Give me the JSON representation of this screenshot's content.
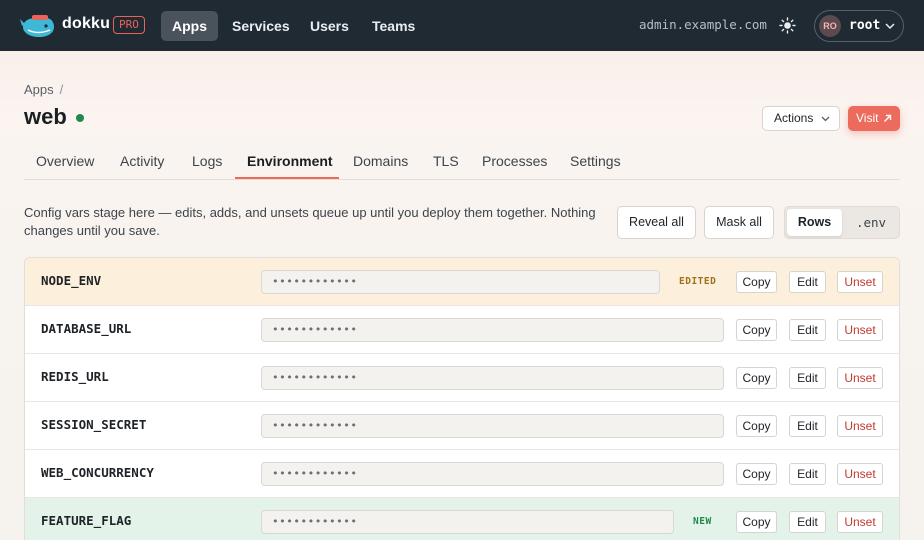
{
  "topbar": {
    "brand": "dokku",
    "pro_badge": "PRO",
    "nav": [
      {
        "label": "Apps",
        "active": true
      },
      {
        "label": "Services",
        "active": false
      },
      {
        "label": "Users",
        "active": false
      },
      {
        "label": "Teams",
        "active": false
      }
    ],
    "host": "admin.example.com",
    "theme_icon": "sun-icon",
    "user": {
      "initials": "RO",
      "name": "root"
    }
  },
  "breadcrumb": {
    "parent": "Apps",
    "separator": "/"
  },
  "app": {
    "name": "web",
    "status": "running",
    "status_color": "#1f8a4c"
  },
  "header_actions": {
    "actions_label": "Actions",
    "visit_label": "Visit"
  },
  "tabs": [
    {
      "label": "Overview",
      "active": false
    },
    {
      "label": "Activity",
      "active": false
    },
    {
      "label": "Logs",
      "active": false
    },
    {
      "label": "Environment",
      "active": true
    },
    {
      "label": "Domains",
      "active": false
    },
    {
      "label": "TLS",
      "active": false
    },
    {
      "label": "Processes",
      "active": false
    },
    {
      "label": "Settings",
      "active": false
    }
  ],
  "environment": {
    "description": "Config vars stage here — edits, adds, and unsets queue up until you deploy them together. Nothing changes until you save.",
    "reveal_all_label": "Reveal all",
    "mask_all_label": "Mask all",
    "view_modes": {
      "rows": "Rows",
      "env": ".env",
      "selected": "Rows"
    },
    "row_actions": {
      "copy": "Copy",
      "edit": "Edit",
      "unset": "Unset"
    },
    "vars": [
      {
        "key": "NODE_ENV",
        "value": "••••••••••••",
        "badge": "EDITED"
      },
      {
        "key": "DATABASE_URL",
        "value": "••••••••••••",
        "badge": ""
      },
      {
        "key": "REDIS_URL",
        "value": "••••••••••••",
        "badge": ""
      },
      {
        "key": "SESSION_SECRET",
        "value": "••••••••••••",
        "badge": ""
      },
      {
        "key": "WEB_CONCURRENCY",
        "value": "••••••••••••",
        "badge": ""
      },
      {
        "key": "FEATURE_FLAG",
        "value": "••••••••••••",
        "badge": "NEW"
      }
    ]
  },
  "colors": {
    "accent": "#ec6b5d",
    "topbar": "#1f2a33",
    "edited_row": "#fcf0dc",
    "new_row": "#e3f3ea",
    "unset_text": "#c0392b"
  }
}
